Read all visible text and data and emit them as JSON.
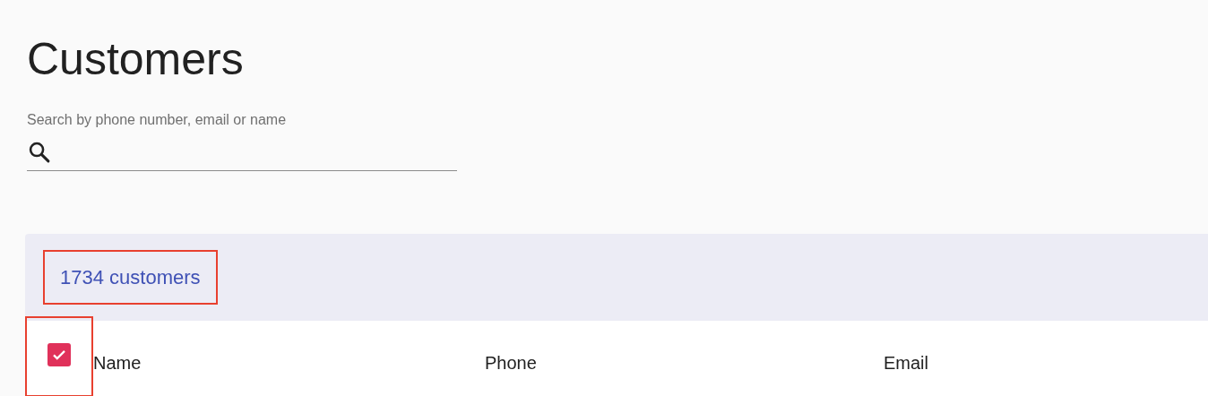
{
  "title": "Customers",
  "search": {
    "label": "Search by phone number, email or name"
  },
  "summary": {
    "count": "1734 customers",
    "highlighted": true
  },
  "select_all": {
    "checked": true,
    "highlighted": true
  },
  "columns": [
    "Name",
    "Phone",
    "Email"
  ]
}
